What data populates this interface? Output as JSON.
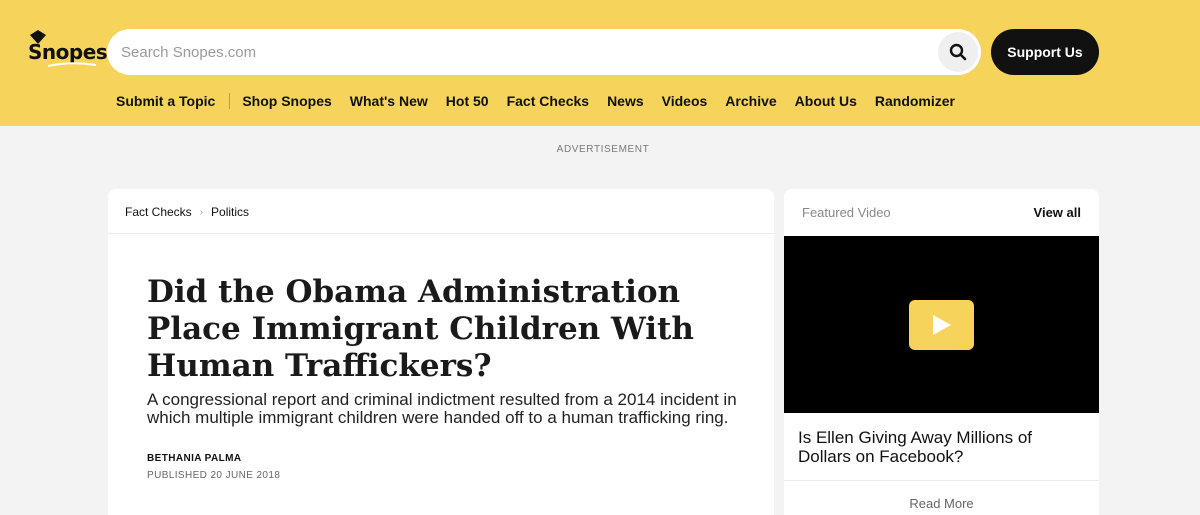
{
  "header": {
    "logo_text": "Snopes",
    "search": {
      "placeholder": "Search Snopes.com",
      "value": ""
    },
    "support_label": "Support Us",
    "nav": [
      "Submit a Topic",
      "Shop Snopes",
      "What's New",
      "Hot 50",
      "Fact Checks",
      "News",
      "Videos",
      "Archive",
      "About Us",
      "Randomizer"
    ]
  },
  "ad_label": "ADVERTISEMENT",
  "article": {
    "breadcrumb": [
      "Fact Checks",
      "Politics"
    ],
    "headline": "Did the Obama Administration Place Immigrant Children With Human Traffickers?",
    "subhead": "A congressional report and criminal indictment resulted from a 2014 incident in which multiple immigrant children were handed off to a human trafficking ring.",
    "author": "BETHANIA PALMA",
    "published": "PUBLISHED 20 JUNE 2018"
  },
  "featured_video": {
    "label": "Featured Video",
    "view_all": "View all",
    "title": "Is Ellen Giving Away Millions of Dollars on Facebook?",
    "read_more": "Read More"
  },
  "colors": {
    "brand_yellow": "#f6d45c",
    "dark": "#111111",
    "page_bg": "#f3f3f3"
  }
}
